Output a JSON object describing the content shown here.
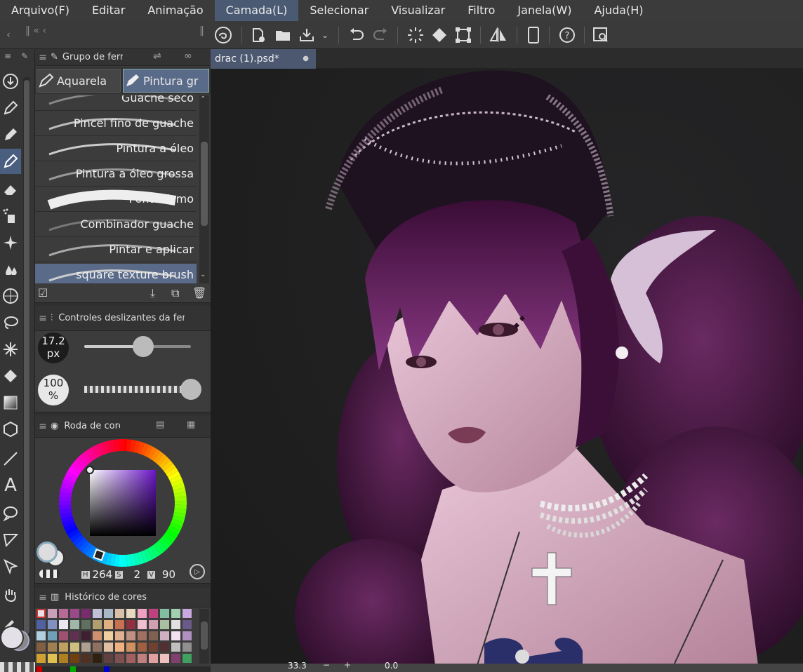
{
  "menu": [
    "Arquivo(F)",
    "Editar",
    "Animação",
    "Camada(L)",
    "Selecionar",
    "Visualizar",
    "Filtro",
    "Janela(W)",
    "Ajuda(H)"
  ],
  "document": {
    "tab_title": "drac (1).psd*",
    "zoom": "33.3",
    "angle": "0.0"
  },
  "tool_group": {
    "title": "Grupo de ferr",
    "tabs": [
      "Aquarela",
      "Pintura gr"
    ],
    "brushes": [
      "Guache seco",
      "Pincel fino de guache",
      "Pintura a óleo",
      "Pintura a óleo grossa",
      "Pontilhismo",
      "Combinador guache",
      "Pintar e aplicar",
      "square texture brush"
    ],
    "selected_brush": "square texture brush"
  },
  "sliders": {
    "title": "Controles deslizantes da ferr",
    "size_value": "17.2",
    "size_unit": "px",
    "size_level": 0.55,
    "opacity_value": "100",
    "opacity_unit": "%",
    "opacity_level": 1.0
  },
  "color_wheel": {
    "title": "Roda de cores",
    "h_label": "H",
    "h": "264",
    "s_label": "S",
    "s": "2",
    "v_label": "V",
    "v": "90",
    "hue_color": "#6a16c8"
  },
  "color_history": {
    "title": "Histórico de cores"
  },
  "colors": {
    "accent": "#4a5f80",
    "selected_brush_bg": "#5a6b8a"
  }
}
